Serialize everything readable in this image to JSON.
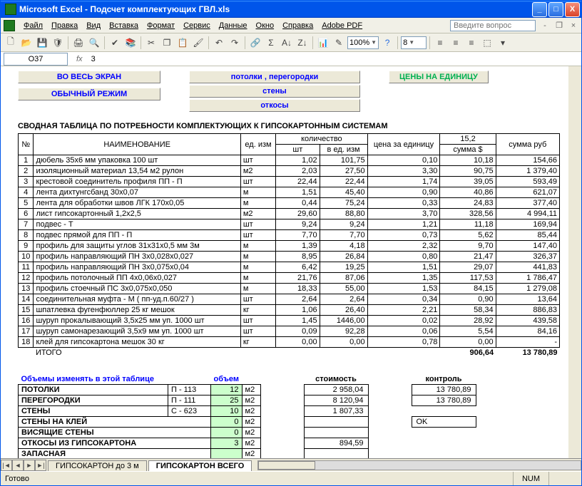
{
  "window": {
    "title": "Microsoft Excel - Подсчет комплектующих ГВЛ.xls"
  },
  "menu": {
    "items": [
      "Файл",
      "Правка",
      "Вид",
      "Вставка",
      "Формат",
      "Сервис",
      "Данные",
      "Окно",
      "Справка",
      "Adobe PDF"
    ],
    "ask_placeholder": "Введите вопрос"
  },
  "toolbar": {
    "zoom": "100%",
    "font_size": "8"
  },
  "fx": {
    "cell": "O37",
    "label": "fx",
    "value": "3"
  },
  "buttons": {
    "full_screen": "ВО ВЕСЬ ЭКРАН",
    "normal_mode": "ОБЫЧНЫЙ РЕЖИМ",
    "ceilings_walls": "потолки ,   перегородки",
    "walls": "стены",
    "otkosy": "откосы",
    "prices": "ЦЕНЫ НА ЕДИНИЦУ"
  },
  "section_title": "СВОДНАЯ ТАБЛИЦА ПО ПОТРЕБНОСТИ КОМПЛЕКТУЮЩИХ К ГИПСОКАРТОННЫМ СИСТЕМАМ",
  "headers": {
    "num": "№",
    "name": "НАИМЕНОВАНИЕ",
    "unit": "ед. изм",
    "qty_group": "количество",
    "qty_pcs": "шт",
    "qty_in_unit": "в ед. изм",
    "price": "цена за единицу",
    "rate": "15,2",
    "sum_usd": "сумма $",
    "sum_rub": "сумма руб"
  },
  "rows": [
    {
      "n": "1",
      "name": "дюбель  35x6 мм  упаковка 100 шт",
      "u": "шт",
      "q1": "1,02",
      "q2": "101,75",
      "p": "0,10",
      "s": "10,18",
      "r": "154,66"
    },
    {
      "n": "2",
      "name": "изоляционный материал 13,54 м2 рулон",
      "u": "м2",
      "q1": "2,03",
      "q2": "27,50",
      "p": "3,30",
      "s": "90,75",
      "r": "1 379,40"
    },
    {
      "n": "3",
      "name": "крестовой соединитель профиля ПП - П",
      "u": "шт",
      "q1": "22,44",
      "q2": "22,44",
      "p": "1,74",
      "s": "39,05",
      "r": "593,49"
    },
    {
      "n": "4",
      "name": "лента дихтунгсбанд  30x0,07",
      "u": "м",
      "q1": "1,51",
      "q2": "45,40",
      "p": "0,90",
      "s": "40,86",
      "r": "621,07"
    },
    {
      "n": "5",
      "name": "лента для обработки швов ЛГК 170x0,05",
      "u": "м",
      "q1": "0,44",
      "q2": "75,24",
      "p": "0,33",
      "s": "24,83",
      "r": "377,40"
    },
    {
      "n": "6",
      "name": "лист гипсокартонный  1,2x2,5",
      "u": "м2",
      "q1": "29,60",
      "q2": "88,80",
      "p": "3,70",
      "s": "328,56",
      "r": "4 994,11"
    },
    {
      "n": "7",
      "name": "подвес - Т",
      "u": "шт",
      "q1": "9,24",
      "q2": "9,24",
      "p": "1,21",
      "s": "11,18",
      "r": "169,94"
    },
    {
      "n": "8",
      "name": "подвес прямой для ПП - П",
      "u": "шт",
      "q1": "7,70",
      "q2": "7,70",
      "p": "0,73",
      "s": "5,62",
      "r": "85,44"
    },
    {
      "n": "9",
      "name": "профиль для защиты углов  31x31x0,5 мм  3м",
      "u": "м",
      "q1": "1,39",
      "q2": "4,18",
      "p": "2,32",
      "s": "9,70",
      "r": "147,40"
    },
    {
      "n": "10",
      "name": "профиль направляющий  ПН  3x0,028x0,027",
      "u": "м",
      "q1": "8,95",
      "q2": "26,84",
      "p": "0,80",
      "s": "21,47",
      "r": "326,37"
    },
    {
      "n": "11",
      "name": "профиль направляющий  ПН  3x0,075x0,04",
      "u": "м",
      "q1": "6,42",
      "q2": "19,25",
      "p": "1,51",
      "s": "29,07",
      "r": "441,83"
    },
    {
      "n": "12",
      "name": "профиль потолочный ПП  4x0,06x0,027",
      "u": "м",
      "q1": "21,76",
      "q2": "87,06",
      "p": "1,35",
      "s": "117,53",
      "r": "1 786,47"
    },
    {
      "n": "13",
      "name": "профиль стоечный ПС  3x0,075x0,050",
      "u": "м",
      "q1": "18,33",
      "q2": "55,00",
      "p": "1,53",
      "s": "84,15",
      "r": "1 279,08"
    },
    {
      "n": "14",
      "name": "соединительная муфта - М ( пп-уд.п.60/27 )",
      "u": "шт",
      "q1": "2,64",
      "q2": "2,64",
      "p": "0,34",
      "s": "0,90",
      "r": "13,64"
    },
    {
      "n": "15",
      "name": "шпатлевка фугенфюллер   25 кг  мешок",
      "u": "кг",
      "q1": "1,06",
      "q2": "26,40",
      "p": "2,21",
      "s": "58,34",
      "r": "886,83"
    },
    {
      "n": "16",
      "name": "шуруп прокалывающий  3,5x25 мм  уп. 1000 шт",
      "u": "шт",
      "q1": "1,45",
      "q2": "1446,00",
      "p": "0,02",
      "s": "28,92",
      "r": "439,58"
    },
    {
      "n": "17",
      "name": "шуруп самонарезающий  3,5x9 мм уп. 1000 шт",
      "u": "шт",
      "q1": "0,09",
      "q2": "92,28",
      "p": "0,06",
      "s": "5,54",
      "r": "84,16"
    },
    {
      "n": "18",
      "name": "клей для гипсокартона  мешок 30 кг",
      "u": "кг",
      "q1": "0,00",
      "q2": "0,00",
      "p": "0,78",
      "s": "0,00",
      "r": "-"
    }
  ],
  "total": {
    "label": "ИТОГО",
    "sum_usd": "906,64",
    "sum_rub": "13 780,89"
  },
  "vol": {
    "title": "Объемы изменять в этой таблице",
    "vol_hdr": "объем",
    "rows": [
      {
        "label": "ПОТОЛКИ",
        "sys": "П - 113",
        "val": "12",
        "u": "м2"
      },
      {
        "label": "ПЕРЕГОРОДКИ",
        "sys": "П - 111",
        "val": "25",
        "u": "м2"
      },
      {
        "label": "СТЕНЫ",
        "sys": "С - 623",
        "val": "10",
        "u": "м2"
      },
      {
        "label": "СТЕНЫ НА КЛЕЙ",
        "sys": "",
        "val": "0",
        "u": "м2"
      },
      {
        "label": "ВИСЯЩИЕ СТЕНЫ",
        "sys": "",
        "val": "0",
        "u": "м2"
      },
      {
        "label": "ОТКОСЫ ИЗ ГИПСОКАРТОНА",
        "sys": "",
        "val": "3",
        "u": "м2"
      },
      {
        "label": "ЗАПАСНАЯ",
        "sys": "",
        "val": "",
        "u": "м2"
      }
    ],
    "cost_hdr": "стоимость",
    "cost": [
      "2 958,04",
      "8 120,94",
      "1 807,33",
      "",
      "",
      "894,59",
      ""
    ],
    "ctrl_hdr": "контроль",
    "ctrl": [
      "13 780,89",
      "13 780,89",
      "",
      "OK"
    ]
  },
  "tabs": {
    "t1": "ГИПСОКАРТОН   до 3 м",
    "t2": "ГИПСОКАРТОН ВСЕГО"
  },
  "status": {
    "ready": "Готово",
    "num": "NUM"
  }
}
